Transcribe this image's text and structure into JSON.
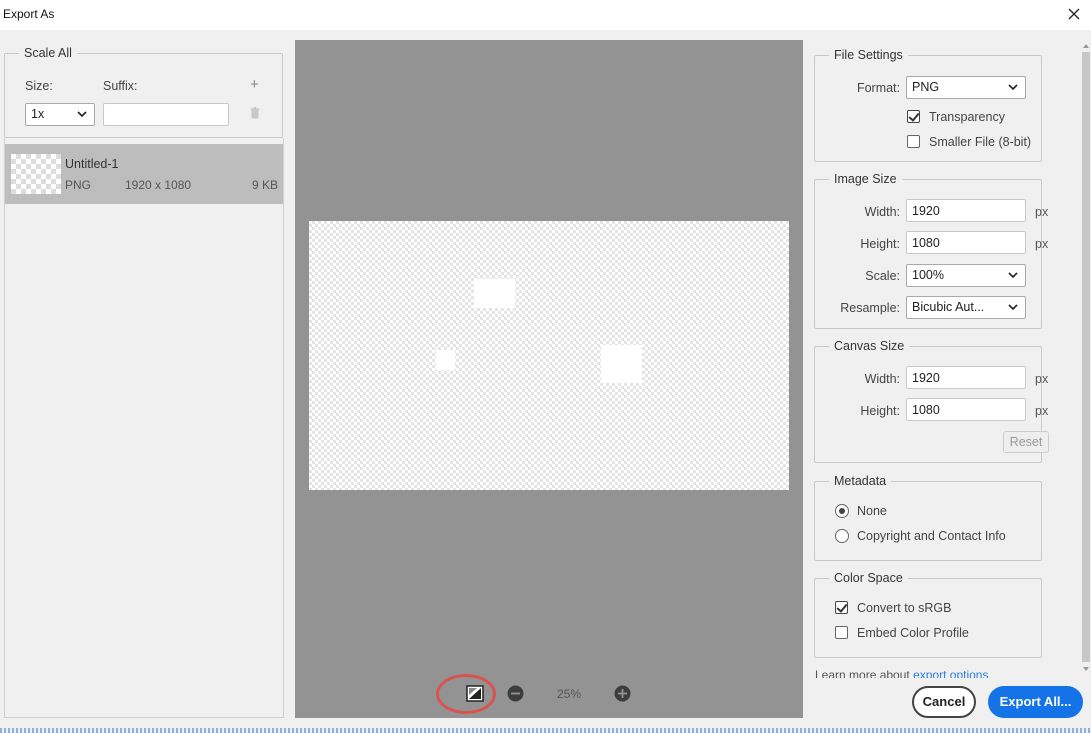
{
  "window": {
    "title": "Export As"
  },
  "scale_all": {
    "legend": "Scale All",
    "size_label": "Size:",
    "suffix_label": "Suffix:",
    "size_value": "1x",
    "suffix_value": "",
    "add_symbol": "+",
    "delete_icon": "trash-icon"
  },
  "asset": {
    "name": "Untitled-1",
    "format": "PNG",
    "dimensions": "1920 x 1080",
    "file_size": "9 KB"
  },
  "preview": {
    "zoom": "25%"
  },
  "file_settings": {
    "legend": "File Settings",
    "format_label": "Format:",
    "format_value": "PNG",
    "transparency_label": "Transparency",
    "transparency_checked": true,
    "smaller_file_label": "Smaller File (8-bit)",
    "smaller_file_checked": false
  },
  "image_size": {
    "legend": "Image Size",
    "width_label": "Width:",
    "width_value": "1920",
    "height_label": "Height:",
    "height_value": "1080",
    "scale_label": "Scale:",
    "scale_value": "100%",
    "resample_label": "Resample:",
    "resample_value": "Bicubic Aut...",
    "unit": "px"
  },
  "canvas_size": {
    "legend": "Canvas Size",
    "width_label": "Width:",
    "width_value": "1920",
    "height_label": "Height:",
    "height_value": "1080",
    "unit": "px",
    "reset_label": "Reset"
  },
  "metadata": {
    "legend": "Metadata",
    "none_label": "None",
    "copyright_label": "Copyright and Contact Info",
    "selected": "None"
  },
  "color_space": {
    "legend": "Color Space",
    "convert_label": "Convert to sRGB",
    "convert_checked": true,
    "embed_label": "Embed Color Profile",
    "embed_checked": false
  },
  "learn_more": {
    "text": "Learn more about",
    "link": "export options"
  },
  "footer": {
    "cancel_label": "Cancel",
    "export_label": "Export All..."
  },
  "colors": {
    "accent": "#1473e6",
    "annotation": "#d9534f",
    "preview_bg": "#939393",
    "selected_row": "#bdbdbd"
  }
}
